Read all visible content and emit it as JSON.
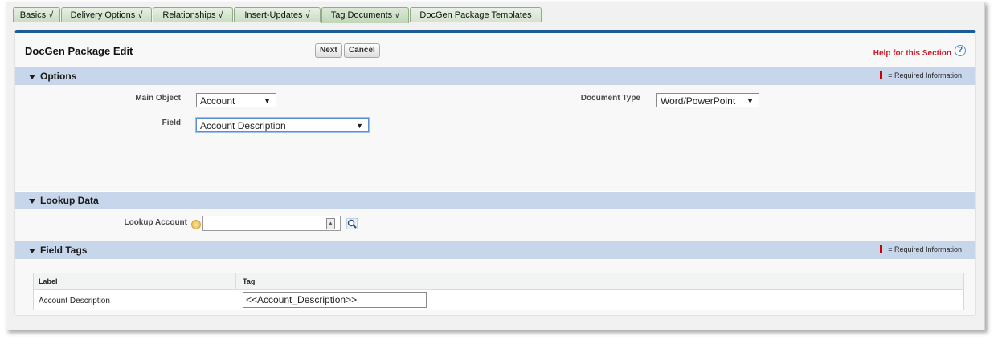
{
  "tabs": [
    {
      "label": "Basics √"
    },
    {
      "label": "Delivery Options √"
    },
    {
      "label": "Relationships √"
    },
    {
      "label": "Insert-Updates √"
    },
    {
      "label": "Tag Documents √"
    },
    {
      "label": "DocGen Package Templates"
    }
  ],
  "header": {
    "title": "DocGen Package Edit",
    "next_label": "Next",
    "cancel_label": "Cancel",
    "help_label": "Help for this Section",
    "help_icon": "?"
  },
  "options": {
    "title": "Options",
    "required_text": "= Required Information",
    "main_object_label": "Main Object",
    "main_object_value": "Account",
    "document_type_label": "Document Type",
    "document_type_value": "Word/PowerPoint",
    "field_label": "Field",
    "field_value": "Account Description"
  },
  "lookup": {
    "title": "Lookup Data",
    "account_label": "Lookup Account",
    "account_value": ""
  },
  "field_tags": {
    "title": "Field Tags",
    "required_text": "= Required Information",
    "columns": [
      "Label",
      "Tag"
    ],
    "rows": [
      {
        "label": "Account Description",
        "tag": "<<Account_Description>>"
      }
    ]
  },
  "colors": {
    "tab_border": "#8fac86",
    "section_header": "#c7d6ea",
    "panel_accent": "#1c5c94",
    "help_red": "#c8202b"
  }
}
